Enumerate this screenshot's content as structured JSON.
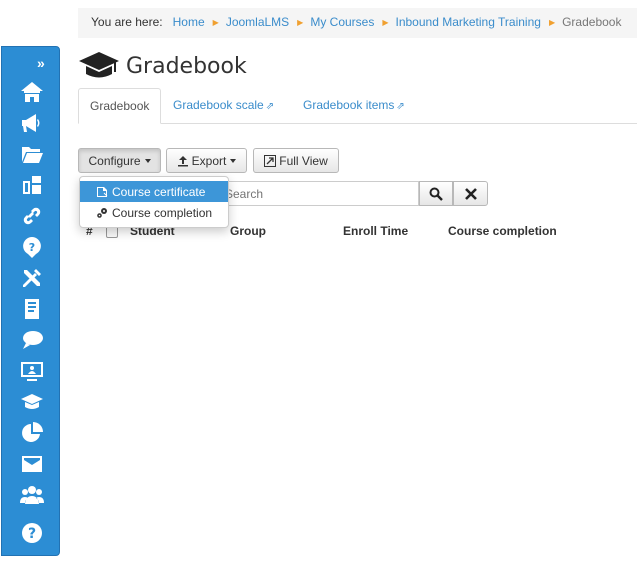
{
  "breadcrumb": {
    "prefix": "You are here:",
    "items": [
      "Home",
      "JoomlaLMS",
      "My Courses",
      "Inbound Marketing Training"
    ],
    "current": "Gradebook"
  },
  "page": {
    "title": "Gradebook"
  },
  "tabs": [
    {
      "label": "Gradebook",
      "active": true
    },
    {
      "label": "Gradebook scale",
      "external": true
    },
    {
      "label": "Gradebook items",
      "external": true
    }
  ],
  "toolbar": {
    "configure_label": "Configure",
    "export_label": "Export",
    "full_view_label": "Full View"
  },
  "configure_menu": [
    {
      "label": "Course certificate",
      "icon": "certificate-icon",
      "highlighted": true
    },
    {
      "label": "Course completion",
      "icon": "gears-icon"
    }
  ],
  "search": {
    "placeholder": "Search",
    "visible_placeholder": "earch"
  },
  "table": {
    "headers": [
      "#",
      "Student",
      "Group",
      "Enroll Time",
      "Course completion"
    ]
  },
  "sidebar": {
    "icons": [
      "home-icon",
      "announcements-icon",
      "documents-icon",
      "groups-icon",
      "links-icon",
      "quiz-icon",
      "tools-icon",
      "homework-icon",
      "chat-icon",
      "presentation-icon",
      "gradebook-icon",
      "reports-icon",
      "mailbox-icon",
      "users-icon",
      "help-icon"
    ]
  },
  "colors": {
    "sidebar": "#2c8dd4",
    "link": "#3a8ccb",
    "breadcrumb_sep": "#f0a030",
    "menu_active": "#3d96d8"
  }
}
